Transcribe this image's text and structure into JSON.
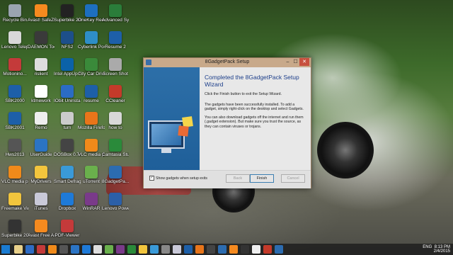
{
  "window": {
    "title": "8GadgetPack Setup",
    "heading": "Completed the 8GadgetPack Setup Wizard",
    "para1": "Click the Finish button to exit the Setup Wizard.",
    "para2": "The gadgets have been successfully installed. To add a gadget, simply right-click on the desktop and select Gadgets.",
    "para3": "You can also download gadgets off the internet and run them (.gadget extension). But make sure you trust the source, as they can contain viruses or trojans.",
    "checkbox_label": "Show gadgets when setup exits",
    "checkbox_checked": true,
    "back_label": "Back",
    "finish_label": "Finish",
    "cancel_label": "Cancel",
    "minimize_glyph": "–",
    "maximize_glyph": "☐",
    "close_glyph": "✕"
  },
  "desktop_icons": [
    {
      "label": "Recycle Bin",
      "color": "#9aa4b0"
    },
    {
      "label": "Avast! SafeZone",
      "color": "#f58a1f"
    },
    {
      "label": "Superbike 2000",
      "color": "#222"
    },
    {
      "label": "OneKey Recovery",
      "color": "#1d6fbf"
    },
    {
      "label": "Advanced SystemCa...",
      "color": "#2a7d3a"
    },
    {
      "label": "Lenovo Telepho...",
      "color": "#d8d8d8"
    },
    {
      "label": "DAEMON Tools Lite",
      "color": "#3a3a3a"
    },
    {
      "label": "NFS2",
      "color": "#1d4f8a"
    },
    {
      "label": "Cyberlink Power2Go",
      "color": "#2e8ec7"
    },
    {
      "label": "Resume 2",
      "color": "#1d5fa8"
    },
    {
      "label": "Motionino...",
      "color": "#c43a3a"
    },
    {
      "label": "rislient",
      "color": "#ddd"
    },
    {
      "label": "Intel AppUp S...",
      "color": "#0b62a8"
    },
    {
      "label": "City Car Drivin...",
      "color": "#3a8a3a"
    },
    {
      "label": "Screen Shot",
      "color": "#aaa"
    },
    {
      "label": "SBK2000",
      "color": "#1d5fa8"
    },
    {
      "label": "ktmework",
      "color": "#fff"
    },
    {
      "label": "IObit Uninstaller",
      "color": "#2b6cc4"
    },
    {
      "label": "resume",
      "color": "#1d5fa8"
    },
    {
      "label": "CCleaner",
      "color": "#c43a2a"
    },
    {
      "label": "SBK2001",
      "color": "#1d5fa8"
    },
    {
      "label": "Remo",
      "color": "#eee"
    },
    {
      "label": "tum",
      "color": "#ccc"
    },
    {
      "label": "Mozilla Firefox",
      "color": "#e8751a"
    },
    {
      "label": "how to",
      "color": "#d8d8d8"
    },
    {
      "label": "Hws2013",
      "color": "#555"
    },
    {
      "label": "UserGuide",
      "color": "#2b74c4"
    },
    {
      "label": "DOSBox 0.74",
      "color": "#444"
    },
    {
      "label": "VLC media pla...",
      "color": "#f08a1a"
    },
    {
      "label": "Camtasia Studio 8",
      "color": "#2a8a3a"
    },
    {
      "label": "VLC media player",
      "color": "#f08a1a"
    },
    {
      "label": "MyDrivers",
      "color": "#f2c53d"
    },
    {
      "label": "Smart Defrag",
      "color": "#3a9ad8"
    },
    {
      "label": "uTorrent",
      "color": "#6ab04c"
    },
    {
      "label": "8GadgetPa...",
      "color": "#2c6cb0"
    },
    {
      "label": "Freemake Video C...",
      "color": "#f2c53d"
    },
    {
      "label": "iTunes",
      "color": "#c9c9d8"
    },
    {
      "label": "Dropbox",
      "color": "#1e7ad8"
    },
    {
      "label": "WinRAR",
      "color": "#7a3a8a"
    },
    {
      "label": "Lenovo PowerDVD 10",
      "color": "#2b5fa8"
    },
    {
      "label": "Superbike 2011",
      "color": "#333"
    },
    {
      "label": "Avast Free Antivirus",
      "color": "#f58a1f"
    },
    {
      "label": "PDF-Viewer",
      "color": "#c43a3a"
    }
  ],
  "taskbar": {
    "language": "ENG",
    "time": "8:13 PM",
    "date": "2/4/2015"
  }
}
